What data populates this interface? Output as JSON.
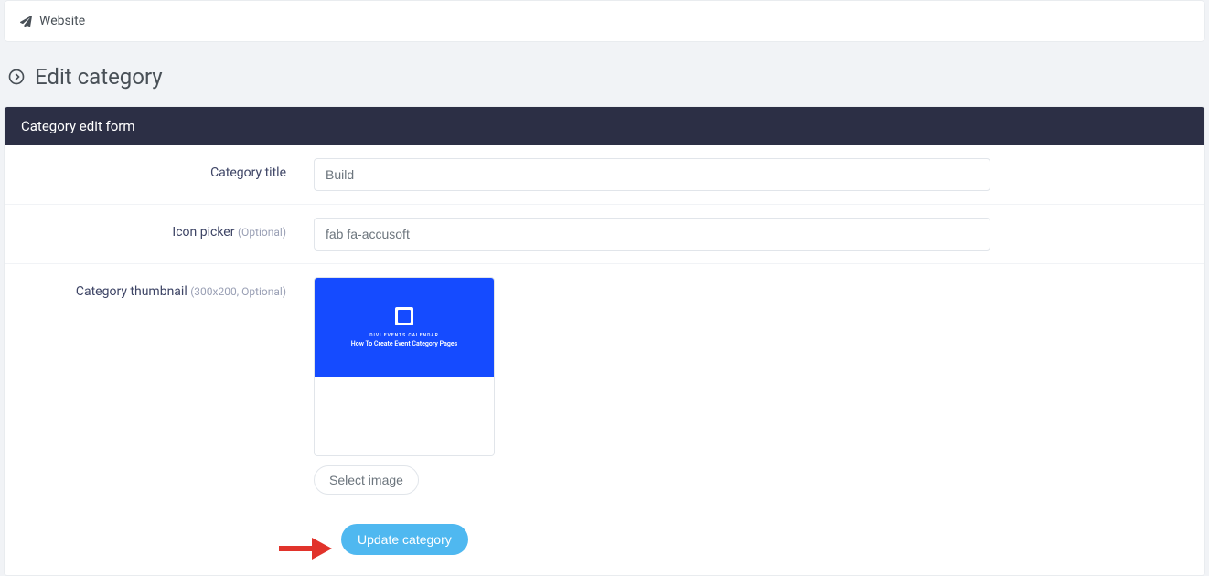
{
  "breadcrumb": {
    "label": "Website"
  },
  "page": {
    "heading": "Edit category"
  },
  "panel": {
    "title": "Category edit form"
  },
  "form": {
    "category_title": {
      "label": "Category title",
      "value": "Build"
    },
    "icon_picker": {
      "label": "Icon picker",
      "hint": "(Optional)",
      "value": "fab fa-accusoft"
    },
    "thumbnail": {
      "label": "Category thumbnail",
      "hint": "(300x200, Optional)",
      "preview_caption_small": "DIVI EVENTS CALENDAR",
      "preview_caption": "How To Create Event Category Pages",
      "select_button": "Select image"
    },
    "submit_label": "Update category"
  },
  "colors": {
    "panel_header": "#2c2f45",
    "primary_button": "#4fb8f0",
    "thumbnail_bg": "#154bff",
    "arrow": "#e1332b"
  }
}
